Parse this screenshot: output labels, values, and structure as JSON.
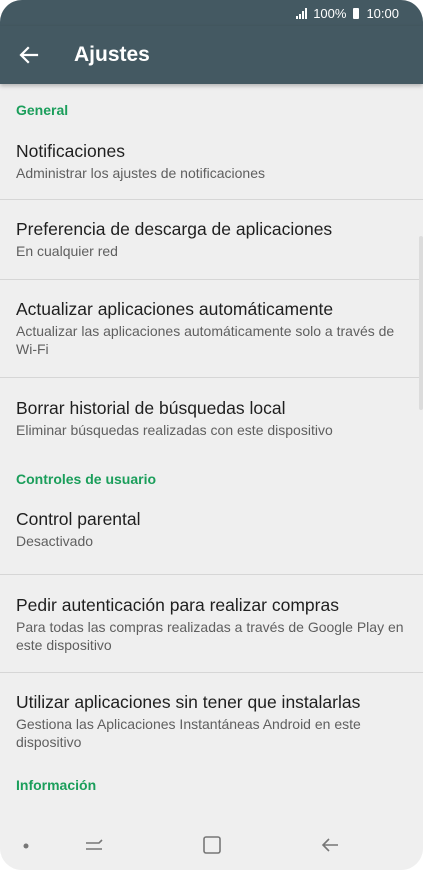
{
  "status": {
    "battery_percent": "100%",
    "time": "10:00"
  },
  "appbar": {
    "title": "Ajustes",
    "back_icon": "arrow-left-icon"
  },
  "sections": {
    "general": {
      "header": "General",
      "notifications": {
        "title": "Notificaciones",
        "sub": "Administrar los ajustes de notificaciones"
      },
      "download_pref": {
        "title": "Preferencia de descarga de aplicaciones",
        "sub": "En cualquier red"
      },
      "auto_update": {
        "title": "Actualizar aplicaciones automáticamente",
        "sub": "Actualizar las aplicaciones automáticamente solo a través de Wi-Fi"
      },
      "clear_history": {
        "title": "Borrar historial de búsquedas local",
        "sub": "Eliminar búsquedas realizadas con este dispositivo"
      }
    },
    "user_controls": {
      "header": "Controles de usuario",
      "parental": {
        "title": "Control parental",
        "sub": "Desactivado"
      },
      "auth": {
        "title": "Pedir autenticación para realizar compras",
        "sub": "Para todas las compras realizadas a través de Google Play en este dispositivo"
      },
      "instant_apps": {
        "title": "Utilizar aplicaciones sin tener que instalarlas",
        "sub": "Gestiona las Aplicaciones Instantáneas Android en este dispositivo"
      }
    },
    "info": {
      "header": "Información"
    }
  },
  "colors": {
    "appbar": "#445962",
    "accent": "#1b9e5b",
    "background": "#efefef"
  }
}
